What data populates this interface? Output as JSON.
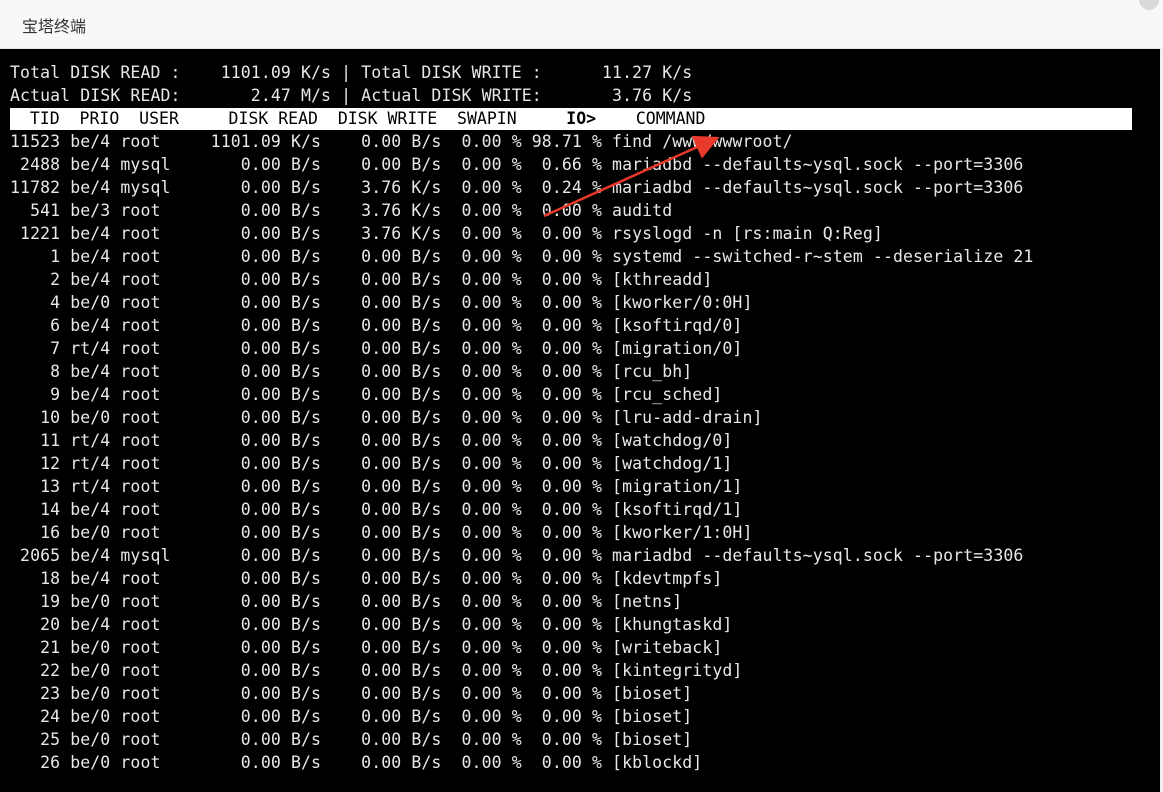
{
  "window": {
    "title": "宝塔终端"
  },
  "summary": [
    "Total DISK READ :    1101.09 K/s | Total DISK WRITE :      11.27 K/s",
    "Actual DISK READ:       2.47 M/s | Actual DISK WRITE:       3.76 K/s"
  ],
  "header": {
    "left": "  TID  PRIO  USER     DISK READ  DISK WRITE  SWAPIN     ",
    "sorted": "IO>",
    "right": "    COMMAND"
  },
  "rows": [
    "11523 be/4 root     1101.09 K/s    0.00 B/s  0.00 % 98.71 % find /www/wwwroot/",
    " 2488 be/4 mysql       0.00 B/s    0.00 B/s  0.00 %  0.66 % mariadbd --defaults~ysql.sock --port=3306",
    "11782 be/4 mysql       0.00 B/s    3.76 K/s  0.00 %  0.24 % mariadbd --defaults~ysql.sock --port=3306",
    "  541 be/3 root        0.00 B/s    3.76 K/s  0.00 %  0.00 % auditd",
    " 1221 be/4 root        0.00 B/s    3.76 K/s  0.00 %  0.00 % rsyslogd -n [rs:main Q:Reg]",
    "    1 be/4 root        0.00 B/s    0.00 B/s  0.00 %  0.00 % systemd --switched-r~stem --deserialize 21",
    "    2 be/4 root        0.00 B/s    0.00 B/s  0.00 %  0.00 % [kthreadd]",
    "    4 be/0 root        0.00 B/s    0.00 B/s  0.00 %  0.00 % [kworker/0:0H]",
    "    6 be/4 root        0.00 B/s    0.00 B/s  0.00 %  0.00 % [ksoftirqd/0]",
    "    7 rt/4 root        0.00 B/s    0.00 B/s  0.00 %  0.00 % [migration/0]",
    "    8 be/4 root        0.00 B/s    0.00 B/s  0.00 %  0.00 % [rcu_bh]",
    "    9 be/4 root        0.00 B/s    0.00 B/s  0.00 %  0.00 % [rcu_sched]",
    "   10 be/0 root        0.00 B/s    0.00 B/s  0.00 %  0.00 % [lru-add-drain]",
    "   11 rt/4 root        0.00 B/s    0.00 B/s  0.00 %  0.00 % [watchdog/0]",
    "   12 rt/4 root        0.00 B/s    0.00 B/s  0.00 %  0.00 % [watchdog/1]",
    "   13 rt/4 root        0.00 B/s    0.00 B/s  0.00 %  0.00 % [migration/1]",
    "   14 be/4 root        0.00 B/s    0.00 B/s  0.00 %  0.00 % [ksoftirqd/1]",
    "   16 be/0 root        0.00 B/s    0.00 B/s  0.00 %  0.00 % [kworker/1:0H]",
    " 2065 be/4 mysql       0.00 B/s    0.00 B/s  0.00 %  0.00 % mariadbd --defaults~ysql.sock --port=3306",
    "   18 be/4 root        0.00 B/s    0.00 B/s  0.00 %  0.00 % [kdevtmpfs]",
    "   19 be/0 root        0.00 B/s    0.00 B/s  0.00 %  0.00 % [netns]",
    "   20 be/4 root        0.00 B/s    0.00 B/s  0.00 %  0.00 % [khungtaskd]",
    "   21 be/0 root        0.00 B/s    0.00 B/s  0.00 %  0.00 % [writeback]",
    "   22 be/0 root        0.00 B/s    0.00 B/s  0.00 %  0.00 % [kintegrityd]",
    "   23 be/0 root        0.00 B/s    0.00 B/s  0.00 %  0.00 % [bioset]",
    "   24 be/0 root        0.00 B/s    0.00 B/s  0.00 %  0.00 % [bioset]",
    "   25 be/0 root        0.00 B/s    0.00 B/s  0.00 %  0.00 % [bioset]",
    "   26 be/0 root        0.00 B/s    0.00 B/s  0.00 %  0.00 % [kblockd]"
  ],
  "colors": {
    "annotation_arrow": "#e8392a",
    "terminal_bg": "#000000",
    "terminal_fg": "#e8e8e8"
  }
}
